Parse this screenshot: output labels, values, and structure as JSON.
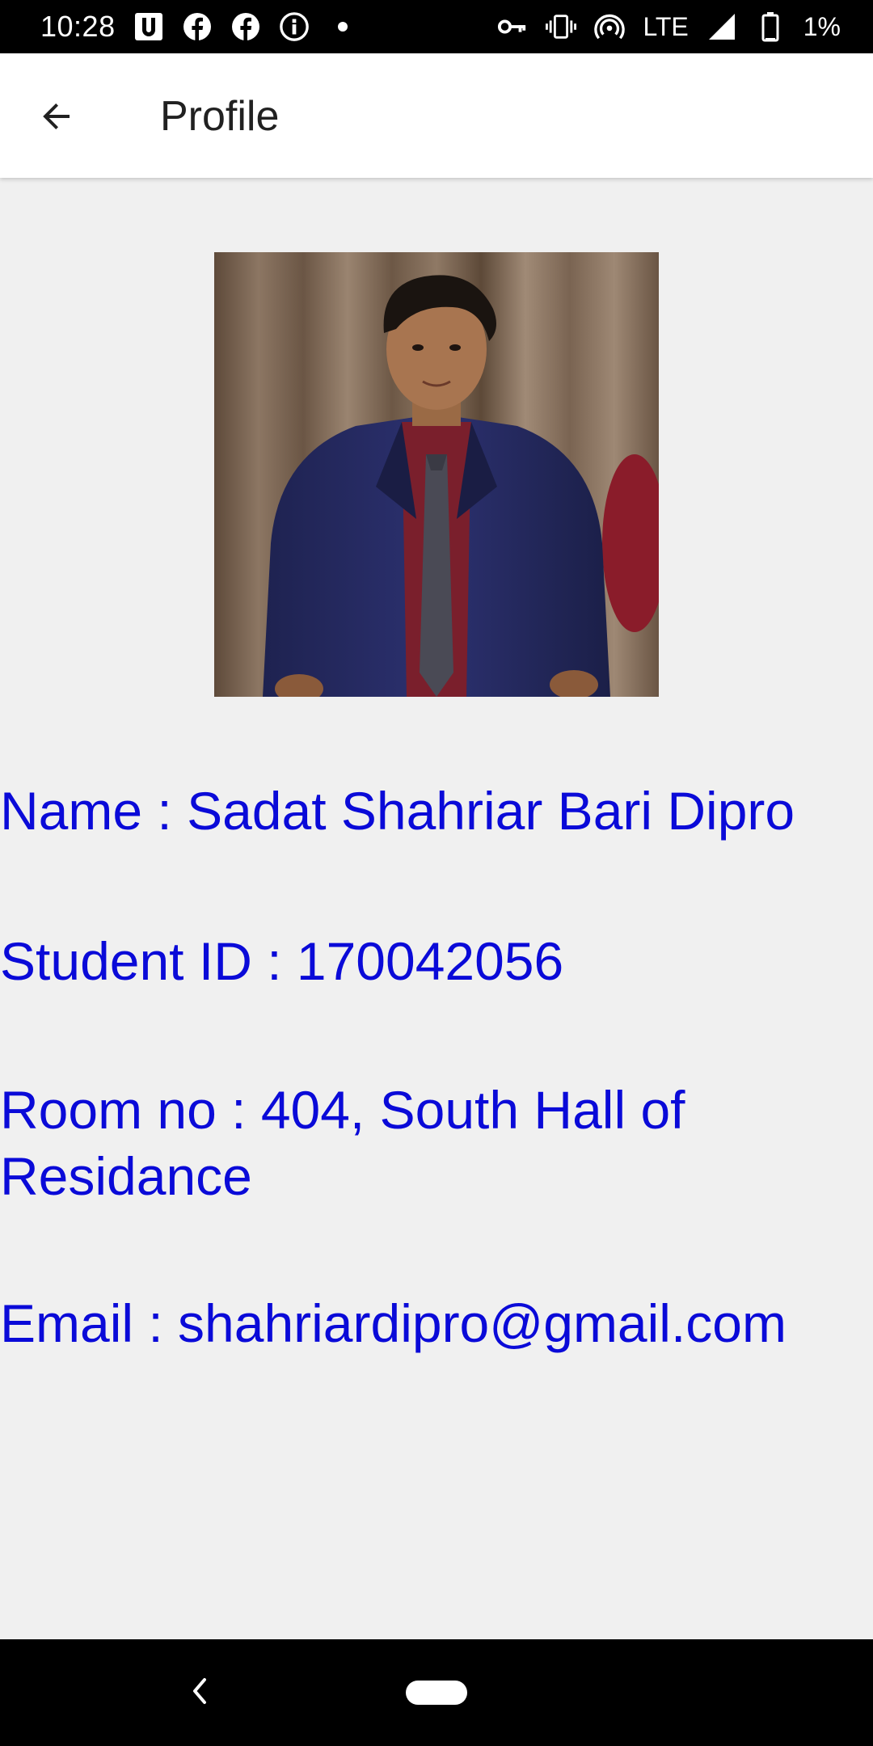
{
  "status_bar": {
    "time": "10:28",
    "network": "LTE",
    "battery": "1%",
    "notification_icons": [
      "u-icon",
      "facebook-icon",
      "facebook-icon",
      "info-icon",
      "dot-icon"
    ],
    "system_icons": [
      "key-icon",
      "vibrate-icon",
      "hotspot-icon",
      "signal-icon",
      "battery-icon"
    ]
  },
  "app_bar": {
    "title": "Profile"
  },
  "profile": {
    "name": "Name : Sadat Shahriar Bari Dipro",
    "student_id": "Student ID : 170042056",
    "room": "Room no : 404, South Hall of Residance",
    "email": "Email : shahriardipro@gmail.com"
  },
  "colors": {
    "info_text": "#0a0ad8",
    "background": "#f0f0f0",
    "app_bar": "#ffffff"
  }
}
